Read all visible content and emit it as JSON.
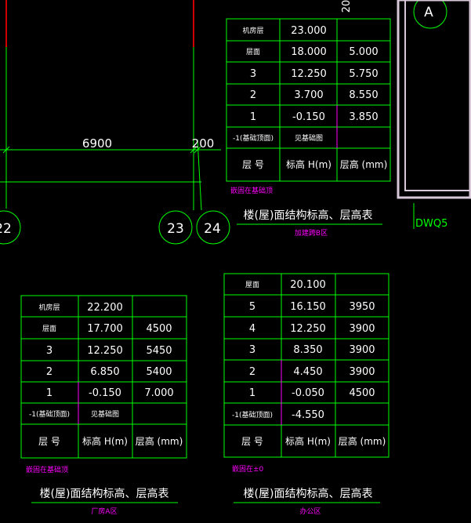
{
  "colors": {
    "background": "#000000",
    "grid_line": "#00ff00",
    "table_line": "#00ff00",
    "text": "#ffffff",
    "note": "#ff00ff",
    "red_line": "#cc0000",
    "wall": "#d8c8d8"
  },
  "dimensions": {
    "span_label": "6900",
    "small_label": "200",
    "top_label": "20"
  },
  "axes": {
    "a22": "22",
    "a23": "23",
    "a24": "24",
    "aA": "A"
  },
  "side_label": "DWQ5",
  "table_b": {
    "header": {
      "floor": "层 号",
      "elev": "标高 H(m)",
      "height": "层高 (mm)"
    },
    "rows": [
      {
        "floor": "机房层",
        "elev": "23.000",
        "height": ""
      },
      {
        "floor": "层面",
        "elev": "18.000",
        "height": "5.000"
      },
      {
        "floor": "3",
        "elev": "12.250",
        "height": "5.750"
      },
      {
        "floor": "2",
        "elev": "3.700",
        "height": "8.550"
      },
      {
        "floor": "1",
        "elev": "-0.150",
        "height": "3.850"
      },
      {
        "floor": "-1(基础顶面)",
        "elev": "见基础图",
        "height": ""
      }
    ],
    "note": "嵌固在基础顶",
    "title": "楼(屋)面结构标高、层高表",
    "subtitle": "加建跨B区"
  },
  "table_a": {
    "header": {
      "floor": "层 号",
      "elev": "标高 H(m)",
      "height": "层高 (mm)"
    },
    "rows": [
      {
        "floor": "机房层",
        "elev": "22.200",
        "height": ""
      },
      {
        "floor": "层面",
        "elev": "17.700",
        "height": "4500"
      },
      {
        "floor": "3",
        "elev": "12.250",
        "height": "5450"
      },
      {
        "floor": "2",
        "elev": "6.850",
        "height": "5400"
      },
      {
        "floor": "1",
        "elev": "-0.150",
        "height": "7.000"
      },
      {
        "floor": "-1(基础顶面)",
        "elev": "见基础图",
        "height": ""
      }
    ],
    "note": "嵌固在基础顶",
    "title": "楼(屋)面结构标高、层高表",
    "subtitle": "厂房A区"
  },
  "table_c": {
    "header": {
      "floor": "层 号",
      "elev": "标高 H(m)",
      "height": "层高 (mm)"
    },
    "rows": [
      {
        "floor": "屋面",
        "elev": "20.100",
        "height": ""
      },
      {
        "floor": "5",
        "elev": "16.150",
        "height": "3950"
      },
      {
        "floor": "4",
        "elev": "12.250",
        "height": "3900"
      },
      {
        "floor": "3",
        "elev": "8.350",
        "height": "3900"
      },
      {
        "floor": "2",
        "elev": "4.450",
        "height": "3900"
      },
      {
        "floor": "1",
        "elev": "-0.050",
        "height": "4500"
      },
      {
        "floor": "-1(基础顶面)",
        "elev": "-4.550",
        "height": ""
      }
    ],
    "note": "嵌固在±0",
    "title": "楼(屋)面结构标高、层高表",
    "subtitle": "办公区"
  }
}
